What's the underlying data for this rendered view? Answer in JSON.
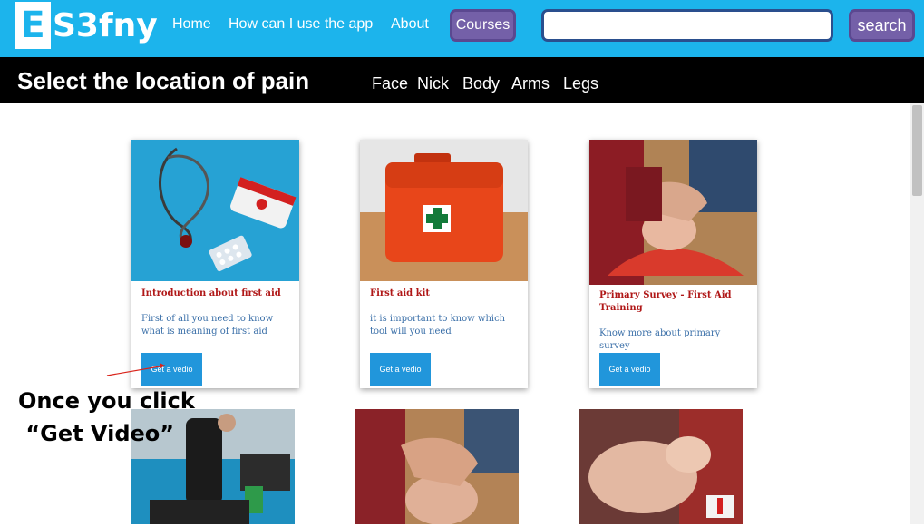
{
  "header": {
    "logo_letter": "E",
    "logo_rest": "S3fny",
    "nav": [
      "Home",
      "How can I use the app",
      "About"
    ],
    "courses_label": "Courses",
    "search_value": "",
    "search_label": "search"
  },
  "location_bar": {
    "title": "Select the location of pain",
    "items": [
      "Face",
      "Nick",
      "Body",
      "Arms",
      "Legs"
    ]
  },
  "cards": [
    {
      "title": "Introduction about first aid",
      "description": "First of all you need to know what is meaning of first aid",
      "button": "Get a vedio",
      "image": "stethoscope-first-aid-kit"
    },
    {
      "title": "First aid kit",
      "description": "it is important to know which tool will you need",
      "button": "Get a vedio",
      "image": "erste-hilfe-case"
    },
    {
      "title": "Primary Survey - First Aid Training",
      "description": "Know more about primary survey",
      "button": "Get a vedio",
      "image": "rescuer-head-hold"
    }
  ],
  "bottom_images": [
    "poolside-rescue",
    "head-tilt-airway",
    "cpr-manikin"
  ],
  "annotation": {
    "line1": "Once you click",
    "line2": " “Get Video”",
    "arrow_color": "#d9231a"
  },
  "colors": {
    "accent": "#1cb4ec",
    "button_purple": "#7460a8",
    "card_button": "#2196db",
    "card_title": "#b01818",
    "card_text": "#3a6fa8"
  }
}
